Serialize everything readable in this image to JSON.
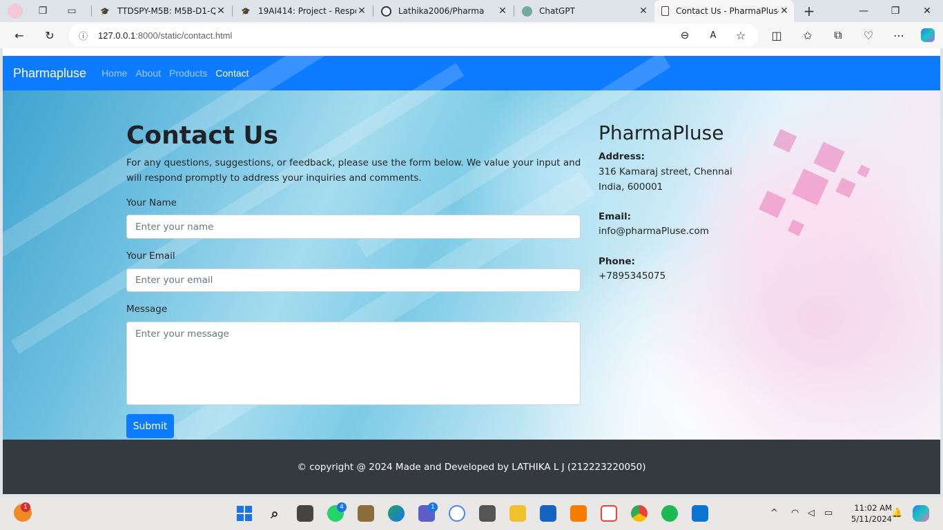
{
  "browser": {
    "tabs": [
      {
        "title": "TTDSPY-M5B: M5B-D1-Q1"
      },
      {
        "title": "19AI414: Project - Response"
      },
      {
        "title": "Lathika2006/Pharma"
      },
      {
        "title": "ChatGPT"
      },
      {
        "title": "Contact Us - PharmaPluse",
        "active": true
      }
    ],
    "url_host": "127.0.0.1",
    "url_rest": ":8000/static/contact.html"
  },
  "nav": {
    "brand": "Pharmapluse",
    "links": [
      "Home",
      "About",
      "Products",
      "Contact"
    ],
    "active": "Contact"
  },
  "contact": {
    "title": "Contact Us",
    "intro": "For any questions, suggestions, or feedback, please use the form below. We value your input and will respond promptly to address your inquiries and comments.",
    "name_label": "Your Name",
    "name_placeholder": "Enter your name",
    "email_label": "Your Email",
    "email_placeholder": "Enter your email",
    "message_label": "Message",
    "message_placeholder": "Enter your message",
    "submit": "Submit"
  },
  "info": {
    "title": "PharmaPluse",
    "address_label": "Address:",
    "address_line1": "316 Kamaraj street, Chennai",
    "address_line2": "India, 600001",
    "email_label": "Email:",
    "email": "info@pharmaPluse.com",
    "phone_label": "Phone:",
    "phone": "+7895345075"
  },
  "footer": {
    "text": "© copyright @ 2024 Made and Developed by LATHIKA L J (212223220050)"
  },
  "taskbar": {
    "weather_badge": "1",
    "whatsapp_badge": "4",
    "teams_badge": "1",
    "time": "11:02 AM",
    "date": "5/11/2024"
  },
  "colors": {
    "accent": "#0d7bff",
    "footer": "#343a40"
  }
}
